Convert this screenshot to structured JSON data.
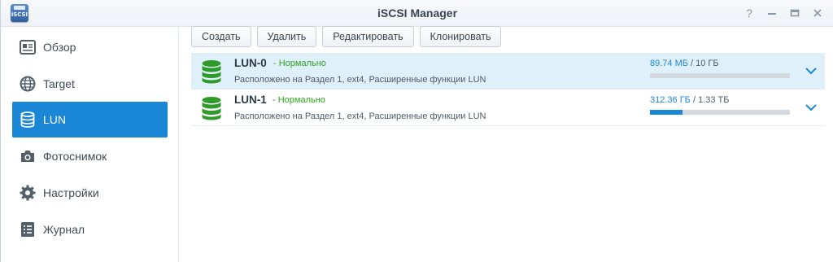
{
  "window": {
    "title": "iSCSI Manager",
    "app_icon_text": "iSCSI"
  },
  "sidebar": {
    "items": [
      {
        "label": "Обзор",
        "icon": "overview-icon",
        "active": false
      },
      {
        "label": "Target",
        "icon": "globe-icon",
        "active": false
      },
      {
        "label": "LUN",
        "icon": "database-icon",
        "active": true
      },
      {
        "label": "Фотоснимок",
        "icon": "camera-icon",
        "active": false
      },
      {
        "label": "Настройки",
        "icon": "gear-icon",
        "active": false
      },
      {
        "label": "Журнал",
        "icon": "log-icon",
        "active": false
      }
    ]
  },
  "toolbar": {
    "create_label": "Создать",
    "delete_label": "Удалить",
    "edit_label": "Редактировать",
    "clone_label": "Клонировать"
  },
  "luns": [
    {
      "name": "LUN-0",
      "status": "- Нормально",
      "description": "Расположено на Раздел 1, ext4, Расширенные функции LUN",
      "used": "89.74 МБ",
      "total": "/ 10 ГБ",
      "usage_fraction": 0.0,
      "selected": true
    },
    {
      "name": "LUN-1",
      "status": "- Нормально",
      "description": "Расположено на Раздел 1, ext4, Расширенные функции LUN",
      "used": "312.36 ГБ",
      "total": "/ 1.33 ТБ",
      "usage_fraction": 0.23,
      "selected": false
    }
  ],
  "colors": {
    "accent": "#1a87d6",
    "status_ok": "#2ea51a",
    "lun_icon": "#2e9a2a"
  }
}
